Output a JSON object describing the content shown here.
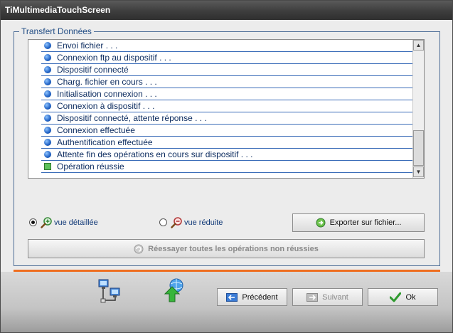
{
  "window": {
    "title": "TiMultimediaTouchScreen"
  },
  "group": {
    "legend": "Transfert Données"
  },
  "log": {
    "items": [
      {
        "text": "Envoi fichier . . .",
        "icon": "blue-dot-icon"
      },
      {
        "text": "Connexion ftp au dispositif . . .",
        "icon": "blue-dot-icon"
      },
      {
        "text": "Dispositif connecté",
        "icon": "blue-dot-icon"
      },
      {
        "text": "Charg. fichier en cours . . .",
        "icon": "blue-dot-icon"
      },
      {
        "text": "Initialisation connexion . . .",
        "icon": "blue-dot-icon"
      },
      {
        "text": "Connexion à dispositif . . .",
        "icon": "blue-dot-icon"
      },
      {
        "text": "Dispositif connecté, attente réponse . . .",
        "icon": "blue-dot-icon"
      },
      {
        "text": "Connexion effectuée",
        "icon": "blue-dot-icon"
      },
      {
        "text": "Authentification effectuée",
        "icon": "blue-dot-icon"
      },
      {
        "text": "Attente fin des opérations en cours sur dispositif . . .",
        "icon": "blue-dot-icon"
      },
      {
        "text": "Opération réussie",
        "icon": "green-square-icon"
      }
    ]
  },
  "view": {
    "detailed_label": "vue détaillée",
    "reduced_label": "vue réduite",
    "selected": "detailed"
  },
  "buttons": {
    "export": "Exporter sur fichier...",
    "retry": "Réessayer toutes les opérations non réussies",
    "previous": "Précédent",
    "next": "Suivant",
    "ok": "Ok"
  },
  "colors": {
    "accent_orange": "#ef6e1f",
    "titlebar": "#3d3d3d",
    "row_line": "#3a6cb8",
    "text_blue": "#0a2a5e"
  }
}
